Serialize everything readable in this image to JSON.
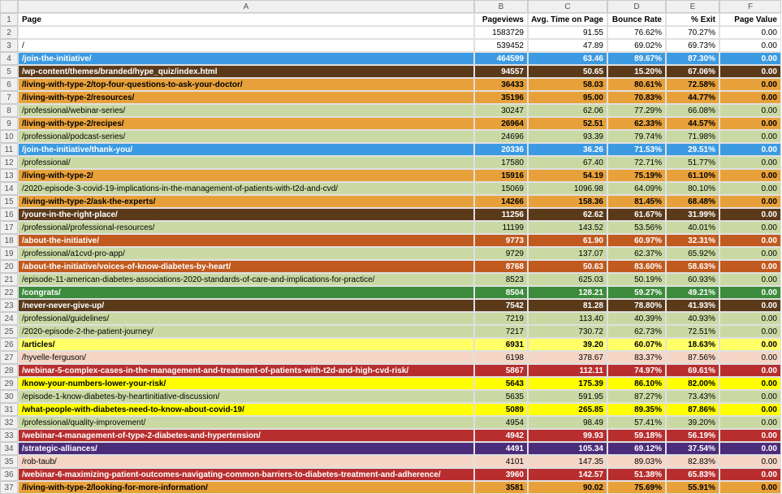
{
  "columns": [
    "A",
    "B",
    "C",
    "D",
    "E",
    "F"
  ],
  "headers": {
    "page": "Page",
    "pageviews": "Pageviews",
    "avg_time": "Avg. Time on Page",
    "bounce": "Bounce Rate",
    "exit": "% Exit",
    "value": "Page Value"
  },
  "rows": [
    {
      "n": 2,
      "page": "",
      "pv": "1583729",
      "at": "91.55",
      "br": "76.62%",
      "ex": "70.27%",
      "val": "0.00",
      "cls": "r-none"
    },
    {
      "n": 3,
      "page": "/",
      "pv": "539452",
      "at": "47.89",
      "br": "69.02%",
      "ex": "69.73%",
      "val": "0.00",
      "cls": "r-none"
    },
    {
      "n": 4,
      "page": "/join-the-initiative/",
      "pv": "464599",
      "at": "63.46",
      "br": "89.67%",
      "ex": "87.30%",
      "val": "0.00",
      "cls": "r-blue"
    },
    {
      "n": 5,
      "page": "/wp-content/themes/branded/hype_quiz/index.html",
      "pv": "94557",
      "at": "50.65",
      "br": "15.20%",
      "ex": "67.06%",
      "val": "0.00",
      "cls": "r-brown"
    },
    {
      "n": 6,
      "page": "/living-with-type-2/top-four-questions-to-ask-your-doctor/",
      "pv": "36433",
      "at": "58.03",
      "br": "80.61%",
      "ex": "72.58%",
      "val": "0.00",
      "cls": "r-orange"
    },
    {
      "n": 7,
      "page": "/living-with-type-2/resources/",
      "pv": "35196",
      "at": "95.00",
      "br": "70.83%",
      "ex": "44.77%",
      "val": "0.00",
      "cls": "r-orange"
    },
    {
      "n": 8,
      "page": "/professional/webinar-series/",
      "pv": "30247",
      "at": "62.06",
      "br": "77.29%",
      "ex": "66.08%",
      "val": "0.00",
      "cls": "r-olive-lt"
    },
    {
      "n": 9,
      "page": "/living-with-type-2/recipes/",
      "pv": "26964",
      "at": "52.51",
      "br": "62.33%",
      "ex": "44.57%",
      "val": "0.00",
      "cls": "r-orange"
    },
    {
      "n": 10,
      "page": "/professional/podcast-series/",
      "pv": "24696",
      "at": "93.39",
      "br": "79.74%",
      "ex": "71.98%",
      "val": "0.00",
      "cls": "r-olive-lt"
    },
    {
      "n": 11,
      "page": "/join-the-initiative/thank-you/",
      "pv": "20336",
      "at": "36.26",
      "br": "71.53%",
      "ex": "29.51%",
      "val": "0.00",
      "cls": "r-blue"
    },
    {
      "n": 12,
      "page": "/professional/",
      "pv": "17580",
      "at": "67.40",
      "br": "72.71%",
      "ex": "51.77%",
      "val": "0.00",
      "cls": "r-olive-lt"
    },
    {
      "n": 13,
      "page": "/living-with-type-2/",
      "pv": "15916",
      "at": "54.19",
      "br": "75.19%",
      "ex": "61.10%",
      "val": "0.00",
      "cls": "r-orange"
    },
    {
      "n": 14,
      "page": "/2020-episode-3-covid-19-implications-in-the-management-of-patients-with-t2d-and-cvd/",
      "pv": "15069",
      "at": "1096.98",
      "br": "64.09%",
      "ex": "80.10%",
      "val": "0.00",
      "cls": "r-olive-lt"
    },
    {
      "n": 15,
      "page": "/living-with-type-2/ask-the-experts/",
      "pv": "14266",
      "at": "158.36",
      "br": "81.45%",
      "ex": "68.48%",
      "val": "0.00",
      "cls": "r-orange"
    },
    {
      "n": 16,
      "page": "/youre-in-the-right-place/",
      "pv": "11256",
      "at": "62.62",
      "br": "61.67%",
      "ex": "31.99%",
      "val": "0.00",
      "cls": "r-brown"
    },
    {
      "n": 17,
      "page": "/professional/professional-resources/",
      "pv": "11199",
      "at": "143.52",
      "br": "53.56%",
      "ex": "40.01%",
      "val": "0.00",
      "cls": "r-olive-lt"
    },
    {
      "n": 18,
      "page": "/about-the-initiative/",
      "pv": "9773",
      "at": "61.90",
      "br": "60.97%",
      "ex": "32.31%",
      "val": "0.00",
      "cls": "r-orange-dk"
    },
    {
      "n": 19,
      "page": "/professional/a1cvd-pro-app/",
      "pv": "9729",
      "at": "137.07",
      "br": "62.37%",
      "ex": "65.92%",
      "val": "0.00",
      "cls": "r-olive-lt"
    },
    {
      "n": 20,
      "page": "/about-the-initiative/voices-of-know-diabetes-by-heart/",
      "pv": "8768",
      "at": "50.63",
      "br": "83.60%",
      "ex": "58.63%",
      "val": "0.00",
      "cls": "r-orange-dk"
    },
    {
      "n": 21,
      "page": "/episode-11-american-diabetes-associations-2020-standards-of-care-and-implications-for-practice/",
      "pv": "8523",
      "at": "625.03",
      "br": "50.19%",
      "ex": "60.93%",
      "val": "0.00",
      "cls": "r-olive-lt"
    },
    {
      "n": 22,
      "page": "/congrats/",
      "pv": "8504",
      "at": "128.21",
      "br": "59.27%",
      "ex": "49.21%",
      "val": "0.00",
      "cls": "r-green-dk"
    },
    {
      "n": 23,
      "page": "/never-never-give-up/",
      "pv": "7542",
      "at": "81.28",
      "br": "78.80%",
      "ex": "41.93%",
      "val": "0.00",
      "cls": "r-brown"
    },
    {
      "n": 24,
      "page": "/professional/guidelines/",
      "pv": "7219",
      "at": "113.40",
      "br": "40.39%",
      "ex": "40.93%",
      "val": "0.00",
      "cls": "r-olive-lt"
    },
    {
      "n": 25,
      "page": "/2020-episode-2-the-patient-journey/",
      "pv": "7217",
      "at": "730.72",
      "br": "62.73%",
      "ex": "72.51%",
      "val": "0.00",
      "cls": "r-olive-lt"
    },
    {
      "n": 26,
      "page": "/articles/",
      "pv": "6931",
      "at": "39.20",
      "br": "60.07%",
      "ex": "18.63%",
      "val": "0.00",
      "cls": "r-yellow"
    },
    {
      "n": 27,
      "page": "/hyvelle-ferguson/",
      "pv": "6198",
      "at": "378.67",
      "br": "83.37%",
      "ex": "87.56%",
      "val": "0.00",
      "cls": "r-peach"
    },
    {
      "n": 28,
      "page": "/webinar-5-complex-cases-in-the-management-and-treatment-of-patients-with-t2d-and-high-cvd-risk/",
      "pv": "5867",
      "at": "112.11",
      "br": "74.97%",
      "ex": "69.61%",
      "val": "0.00",
      "cls": "r-red"
    },
    {
      "n": 29,
      "page": "/know-your-numbers-lower-your-risk/",
      "pv": "5643",
      "at": "175.39",
      "br": "86.10%",
      "ex": "82.00%",
      "val": "0.00",
      "cls": "r-yellow-br"
    },
    {
      "n": 30,
      "page": "/episode-1-know-diabetes-by-heartinitiative-discussion/",
      "pv": "5635",
      "at": "591.95",
      "br": "87.27%",
      "ex": "73.43%",
      "val": "0.00",
      "cls": "r-olive-lt"
    },
    {
      "n": 31,
      "page": "/what-people-with-diabetes-need-to-know-about-covid-19/",
      "pv": "5089",
      "at": "265.85",
      "br": "89.35%",
      "ex": "87.86%",
      "val": "0.00",
      "cls": "r-yellow-br"
    },
    {
      "n": 32,
      "page": "/professional/quality-improvement/",
      "pv": "4954",
      "at": "98.49",
      "br": "57.41%",
      "ex": "39.20%",
      "val": "0.00",
      "cls": "r-olive-lt"
    },
    {
      "n": 33,
      "page": "/webinar-4-management-of-type-2-diabetes-and-hypertension/",
      "pv": "4942",
      "at": "99.93",
      "br": "59.18%",
      "ex": "56.19%",
      "val": "0.00",
      "cls": "r-red"
    },
    {
      "n": 34,
      "page": "/strategic-alliances/",
      "pv": "4491",
      "at": "105.34",
      "br": "69.12%",
      "ex": "37.54%",
      "val": "0.00",
      "cls": "r-purple"
    },
    {
      "n": 35,
      "page": "/rob-taub/",
      "pv": "4101",
      "at": "147.35",
      "br": "89.03%",
      "ex": "82.83%",
      "val": "0.00",
      "cls": "r-peach"
    },
    {
      "n": 36,
      "page": "/webinar-6-maximizing-patient-outcomes-navigating-common-barriers-to-diabetes-treatment-and-adherence/",
      "pv": "3960",
      "at": "142.57",
      "br": "51.38%",
      "ex": "65.83%",
      "val": "0.00",
      "cls": "r-red"
    },
    {
      "n": 37,
      "page": "/living-with-type-2/looking-for-more-information/",
      "pv": "3581",
      "at": "90.02",
      "br": "75.69%",
      "ex": "55.91%",
      "val": "0.00",
      "cls": "r-orange"
    }
  ]
}
